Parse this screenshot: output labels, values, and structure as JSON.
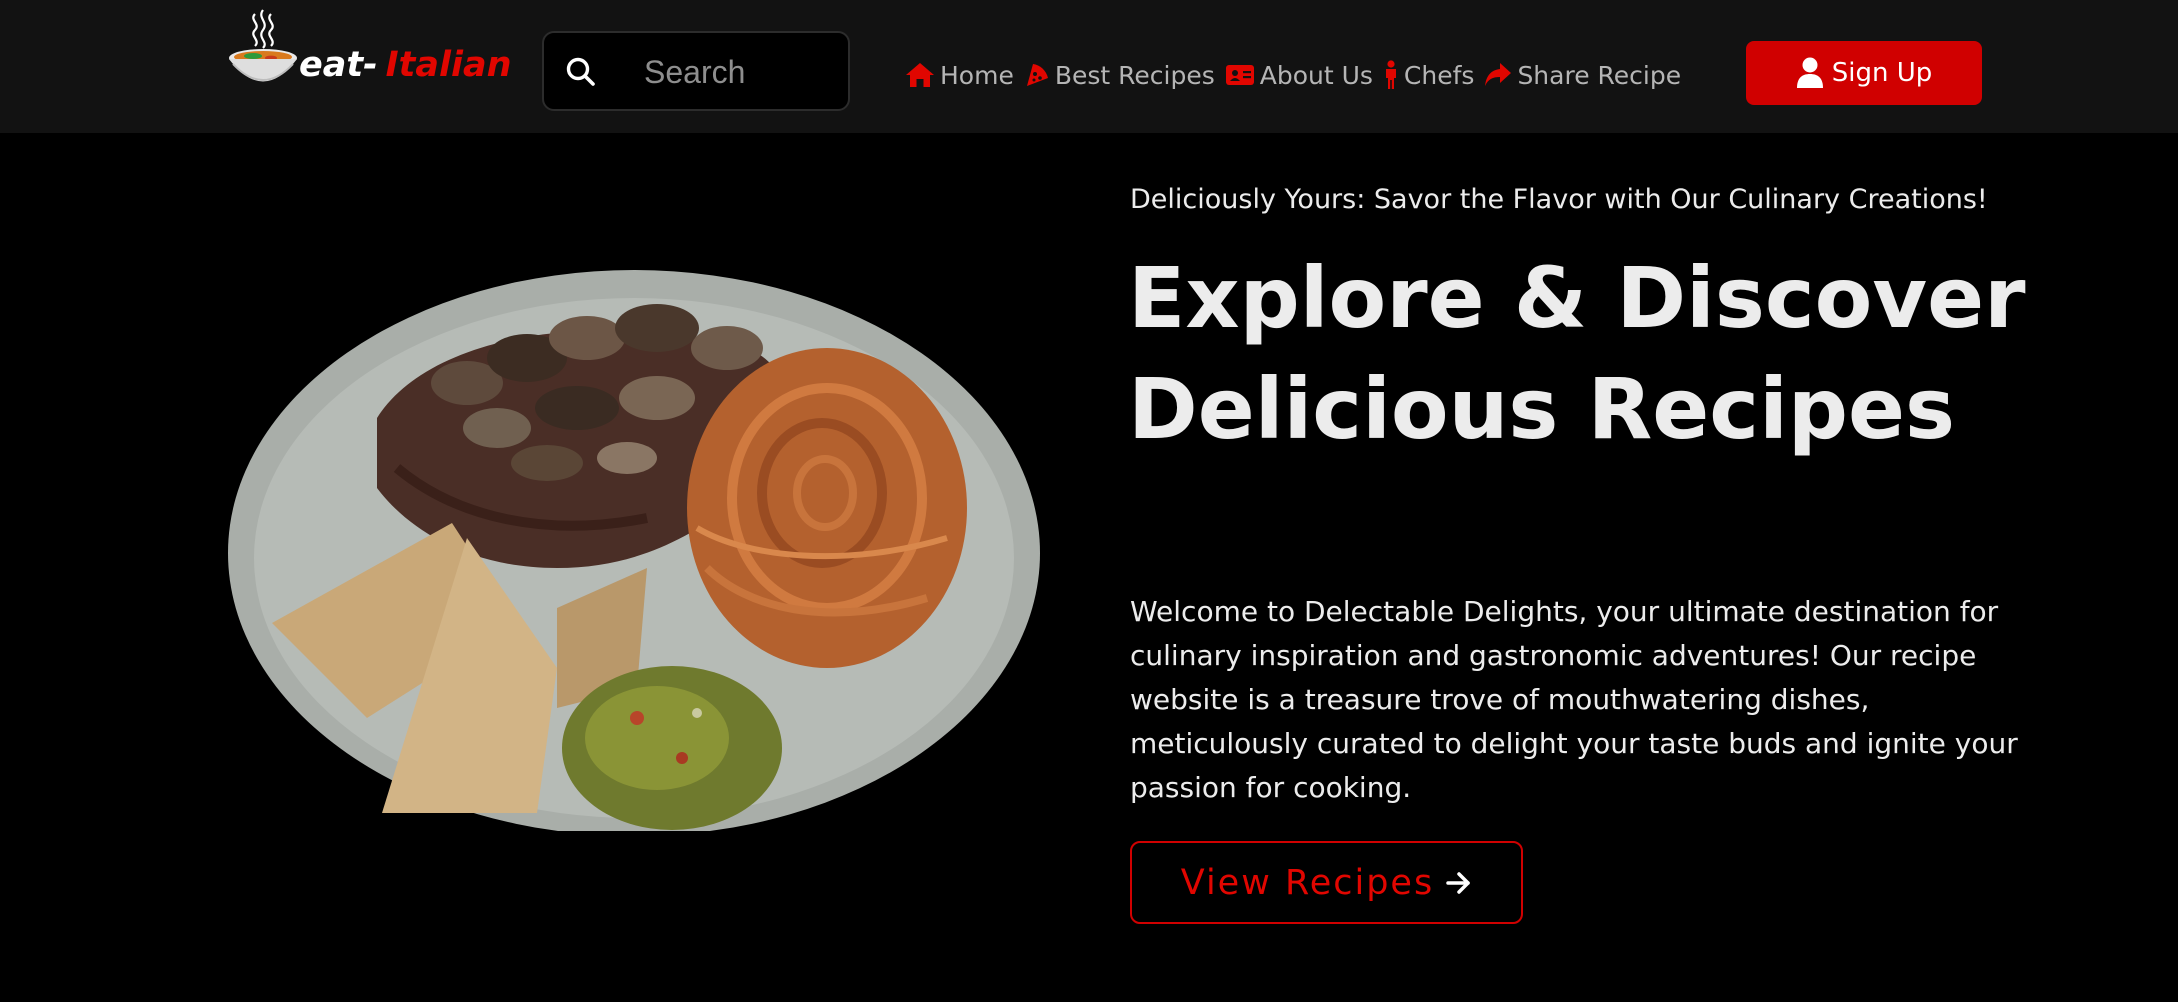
{
  "brand": {
    "name_white": "eat-",
    "name_red": "Italian"
  },
  "search": {
    "placeholder": "Search"
  },
  "nav": {
    "items": [
      {
        "label": "Home",
        "icon": "home-icon"
      },
      {
        "label": "Best Recipes",
        "icon": "pizza-slice-icon"
      },
      {
        "label": "About Us",
        "icon": "id-card-icon"
      },
      {
        "label": "Chefs",
        "icon": "person-icon"
      },
      {
        "label": "Share Recipe",
        "icon": "share-arrow-icon"
      }
    ],
    "signup_label": "Sign Up"
  },
  "hero": {
    "tagline": "Deliciously Yours: Savor the Flavor with Our Culinary Creations!",
    "headline": "Explore & Discover Delicious Recipes",
    "intro": "Welcome to Delectable Delights, your ultimate destination for culinary inspiration and gastronomic adventures! Our recipe website is a treasure trove of mouthwatering dishes, meticulously curated to delight your taste buds and ignite your passion for cooking.",
    "cta_label": "View Recipes"
  },
  "colors": {
    "accent": "#d00000",
    "navbar_bg": "#121212",
    "page_bg": "#000000",
    "text": "#ececec",
    "nav_text": "#b5b5b5"
  }
}
